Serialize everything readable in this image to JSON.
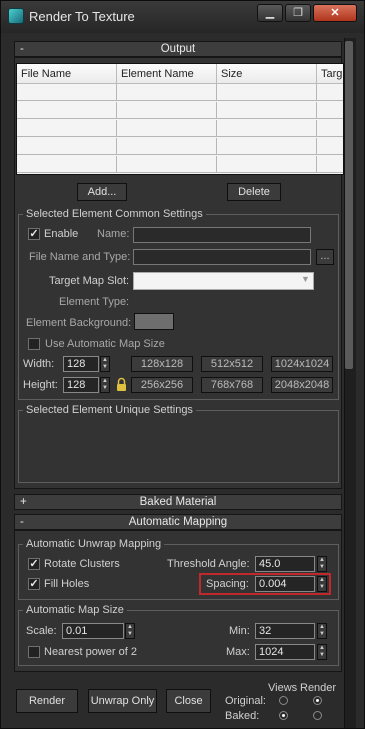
{
  "window": {
    "title": "Render To Texture",
    "min_symbol": "▁",
    "max_symbol": "❐",
    "close_symbol": "✕"
  },
  "output": {
    "rollout_title": "Output",
    "rollout_sign": "-",
    "columns": [
      "File Name",
      "Element Name",
      "Size",
      "Targ"
    ],
    "add_button": "Add...",
    "delete_button": "Delete",
    "common": {
      "group_title": "Selected Element Common Settings",
      "enable_label": "Enable",
      "enable_checked": true,
      "name_label": "Name:",
      "name_value": "",
      "file_label": "File Name and Type:",
      "file_value": "",
      "browse_label": "...",
      "target_slot_label": "Target Map Slot:",
      "target_slot_value": "",
      "element_type_label": "Element Type:",
      "element_bg_label": "Element Background:",
      "element_bg_color": "#6e6e6e",
      "auto_size_label": "Use Automatic Map Size",
      "auto_size_checked": false,
      "width_label": "Width:",
      "width_value": "128",
      "height_label": "Height:",
      "height_value": "128",
      "presets": [
        "128x128",
        "512x512",
        "1024x1024",
        "256x256",
        "768x768",
        "2048x2048"
      ]
    },
    "unique": {
      "group_title": "Selected Element Unique Settings"
    }
  },
  "baked_material": {
    "rollout_title": "Baked Material",
    "rollout_sign": "+"
  },
  "auto_mapping": {
    "rollout_title": "Automatic Mapping",
    "rollout_sign": "-",
    "unwrap": {
      "group_title": "Automatic Unwrap Mapping",
      "rotate_clusters_label": "Rotate Clusters",
      "rotate_clusters_checked": true,
      "fill_holes_label": "Fill Holes",
      "fill_holes_checked": true,
      "threshold_label": "Threshold Angle:",
      "threshold_value": "45.0",
      "spacing_label": "Spacing:",
      "spacing_value": "0.004",
      "highlight_color": "#c0282d"
    },
    "map_size": {
      "group_title": "Automatic Map Size",
      "scale_label": "Scale:",
      "scale_value": "0.01",
      "nearest_label": "Nearest power of 2",
      "nearest_checked": false,
      "min_label": "Min:",
      "min_value": "32",
      "max_label": "Max:",
      "max_value": "1024"
    }
  },
  "footer": {
    "render_button": "Render",
    "unwrap_only_button": "Unwrap Only",
    "close_button": "Close",
    "views_label": "Views",
    "render_label": "Render",
    "original_label": "Original:",
    "baked_label": "Baked:"
  }
}
